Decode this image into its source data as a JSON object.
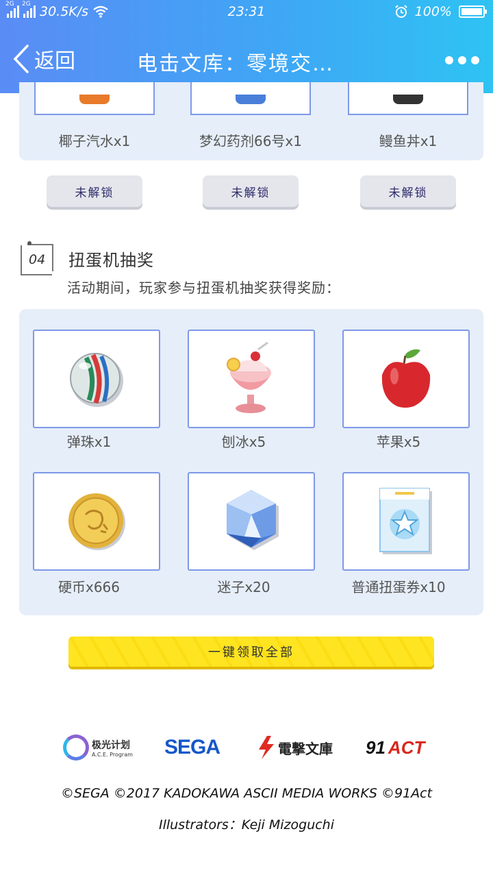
{
  "status_bar": {
    "net1": "2G",
    "net2": "2G",
    "speed": "30.5K/s",
    "time": "23:31",
    "battery": "100%",
    "battery_level": 1.0
  },
  "header": {
    "back_label": "返回",
    "title": "电击文库：零境交…"
  },
  "top_rewards": {
    "items": [
      {
        "name": "椰子汽水x1",
        "icon": "coconut-soda-icon"
      },
      {
        "name": "梦幻药剂66号x1",
        "icon": "potion-icon"
      },
      {
        "name": "鳗鱼丼x1",
        "icon": "eel-bowl-icon"
      }
    ],
    "buttons": [
      "未解锁",
      "未解锁",
      "未解锁"
    ]
  },
  "section": {
    "number": "04",
    "title": "扭蛋机抽奖",
    "description": "活动期间，玩家参与扭蛋机抽奖获得奖励："
  },
  "rewards": [
    {
      "name": "弹珠x1",
      "icon": "marble-icon"
    },
    {
      "name": "刨冰x5",
      "icon": "shaved-ice-icon"
    },
    {
      "name": "苹果x5",
      "icon": "apple-icon"
    },
    {
      "name": "硬币x666",
      "icon": "coin-icon"
    },
    {
      "name": "迷子x20",
      "icon": "crystal-icon"
    },
    {
      "name": "普通扭蛋券x10",
      "icon": "gacha-ticket-icon"
    }
  ],
  "claim_button": "一键领取全部",
  "footer": {
    "logos": {
      "ace_main": "极光计划",
      "ace_sub": "A.C.E. Program",
      "sega": "SEGA",
      "dengeki": "電撃文庫",
      "act_num": "91",
      "act_text": "ACT"
    },
    "copyright": "©SEGA   ©2017 KADOKAWA ASCII MEDIA WORKS ©91Act",
    "illustrators": "Illustrators：Keji Mizoguchi"
  },
  "colors": {
    "header_start": "#5a8cf5",
    "header_end": "#2ec3f3",
    "panel_bg": "#e6eef9",
    "card_border": "#7e98e8",
    "claim_yellow": "#ffe421"
  }
}
